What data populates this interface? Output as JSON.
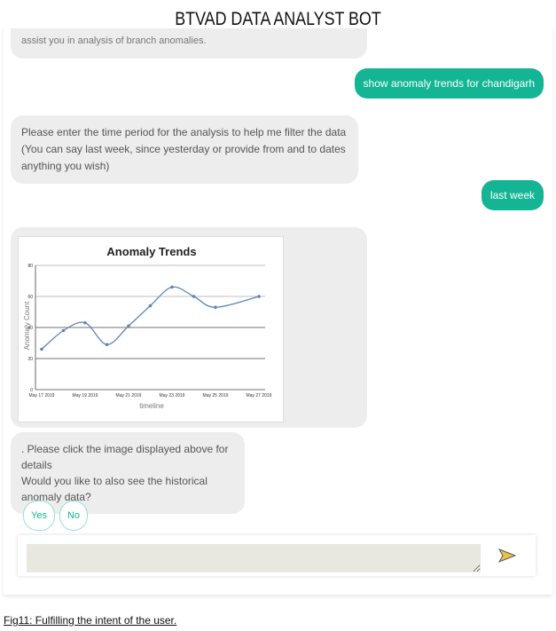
{
  "header": {
    "title": "BTVAD DATA ANALYST BOT"
  },
  "messages": [
    {
      "from": "bot",
      "text": "assist you in analysis of branch anomalies."
    },
    {
      "from": "user",
      "text": "show anomaly trends for chandigarh"
    },
    {
      "from": "bot",
      "text": "Please enter the time period for the analysis to help me filter the data (You can say last week, since yesterday or provide from and to dates anything you wish)"
    },
    {
      "from": "user",
      "text": "last week"
    },
    {
      "from": "bot",
      "text": ". Please click the image displayed above for details"
    },
    {
      "from": "bot",
      "text": "Would you like to also see the historical anomaly data?"
    }
  ],
  "quick_replies": [
    "Yes",
    "No"
  ],
  "input": {
    "value": "",
    "send_icon": "send-arrow-icon"
  },
  "colors": {
    "accent": "#14b594",
    "line": "#5b86b8"
  },
  "caption": "Fig11: Fulfilling the intent of the user.",
  "chart_data": {
    "type": "line",
    "title": "Anomaly Trends",
    "xlabel": "timeline",
    "ylabel": "Anomaly Count",
    "x": [
      "May 17 2019",
      "May 18 2019",
      "May 19 2019",
      "May 20 2019",
      "May 21 2019",
      "May 22 2019",
      "May 23 2019",
      "May 24 2019",
      "May 25 2019",
      "May 27 2019"
    ],
    "values": [
      26,
      38,
      43,
      29,
      41,
      54,
      66,
      60,
      53,
      60
    ],
    "xticks": [
      "May 17 2019",
      "May 19 2019",
      "May 21 2019",
      "May 23 2019",
      "May 25 2019",
      "May 27 2019"
    ],
    "yticks": [
      "0",
      "20",
      "40",
      "60",
      "80"
    ],
    "ylim": [
      0,
      80
    ],
    "grid": true
  }
}
